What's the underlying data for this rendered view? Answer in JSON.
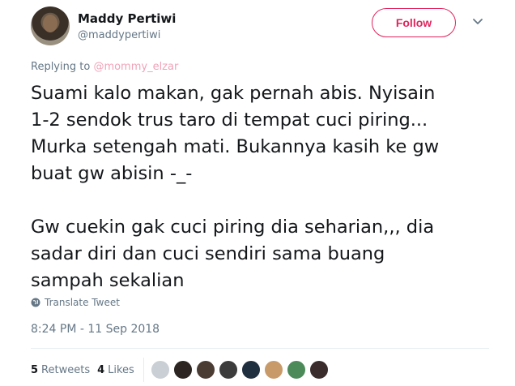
{
  "user": {
    "name": "Maddy Pertiwi",
    "handle": "@maddypertiwi"
  },
  "follow_label": "Follow",
  "replying": {
    "prefix": "Replying to",
    "mention": "@mommy_elzar"
  },
  "tweet": {
    "lines": [
      "Suami kalo makan, gak pernah abis. Nyisain",
      "1-2 sendok trus taro di tempat cuci piring...",
      "Murka setengah mati. Bukannya kasih ke gw",
      "buat gw abisin -_-",
      "Gw cuekin gak cuci piring dia seharian,,, dia",
      "sadar diri dan cuci sendiri sama buang",
      "sampah sekalian"
    ]
  },
  "translate_label": "Translate Tweet",
  "timestamp": "8:24 PM - 11 Sep 2018",
  "stats": {
    "retweets_count": "5",
    "retweets_label": "Retweets",
    "likes_count": "4",
    "likes_label": "Likes"
  },
  "colors": {
    "accent": "#e0245e",
    "secondary_text": "#657786",
    "mention": "#f0a3b8"
  },
  "liker_avatars": [
    {
      "icon": "avatar-default-icon",
      "color": "#c9cfd4"
    },
    {
      "icon": "avatar-icon",
      "color": "#2b2420"
    },
    {
      "icon": "avatar-icon",
      "color": "#4a3b33"
    },
    {
      "icon": "avatar-icon",
      "color": "#3c3c3c"
    },
    {
      "icon": "avatar-icon",
      "color": "#1f2f3f"
    },
    {
      "icon": "avatar-icon",
      "color": "#c89a6a"
    },
    {
      "icon": "avatar-icon",
      "color": "#4d8a5a"
    },
    {
      "icon": "avatar-icon",
      "color": "#3a2c2c"
    }
  ]
}
